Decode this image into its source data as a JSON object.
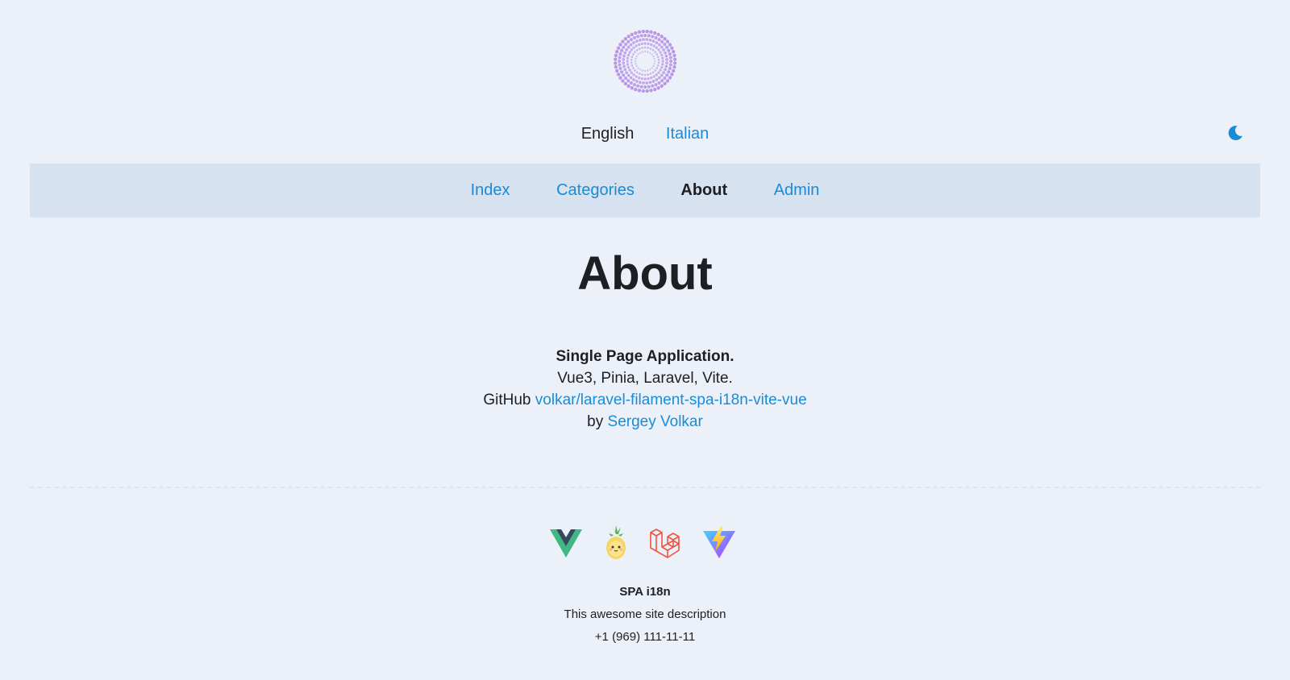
{
  "header": {
    "logo_icon": "dotted-circle-logo-icon",
    "languages": {
      "active": "English",
      "other": "Italian"
    },
    "theme_toggle_icon": "moon-icon"
  },
  "nav": {
    "items": [
      {
        "label": "Index",
        "active": false
      },
      {
        "label": "Categories",
        "active": false
      },
      {
        "label": "About",
        "active": true
      },
      {
        "label": "Admin",
        "active": false
      }
    ]
  },
  "main": {
    "title": "About",
    "headline": "Single Page Application.",
    "stack": "Vue3, Pinia, Laravel, Vite.",
    "github_prefix": "GitHub",
    "github_link": "volkar/laravel-filament-spa-i18n-vite-vue",
    "author_prefix": "by",
    "author_link": "Sergey Volkar"
  },
  "footer": {
    "tech_icons": [
      "vue-icon",
      "pinia-icon",
      "laravel-icon",
      "vite-icon"
    ],
    "site_name": "SPA i18n",
    "description": "This awesome site description",
    "phone": "+1 (969) 111-11-11"
  },
  "colors": {
    "background": "#ecf1f9",
    "nav_background": "#d6e2f0",
    "link": "#1a8bd6",
    "text": "#1d1f22",
    "logo_gradient_start": "#f09ad9",
    "logo_gradient_end": "#7f8cf2"
  }
}
